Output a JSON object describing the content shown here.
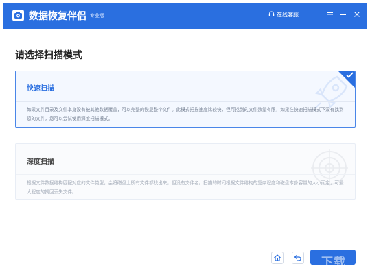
{
  "app": {
    "title": "数据恢复伴侣",
    "edition": "专业版",
    "support_label": "在线客服",
    "brand_color": "#2a6fe0",
    "icons": {
      "logo": "camera-logo-icon",
      "support": "headset-icon",
      "menu": "menu-icon",
      "minimize": "minimize-icon",
      "close": "close-icon"
    }
  },
  "main": {
    "heading": "请选择扫描模式",
    "modes": [
      {
        "title": "快速扫描",
        "description": "如果文件目录及文件本身没有被其他数据覆盖，可以完整的恢复整个文件。此模式扫描速度比较快，但可找到的文件数量有限，如果在快速扫描模式下没有找到您的文件，您可以尝试使用深度扫描模式。",
        "selected": true
      },
      {
        "title": "深度扫描",
        "description": "根据文件数据结构匹配对应的文件类型，会将磁盘上所有文件都找出来，但没有文件名。扫描的时间根据文件结构的复杂程度和磁盘本身容量的大小而定，可最大程度的找回丢失文件。",
        "selected": false
      }
    ]
  },
  "footer": {
    "home_icon": "home-icon",
    "back_icon": "back-icon",
    "watermark": "下载"
  }
}
